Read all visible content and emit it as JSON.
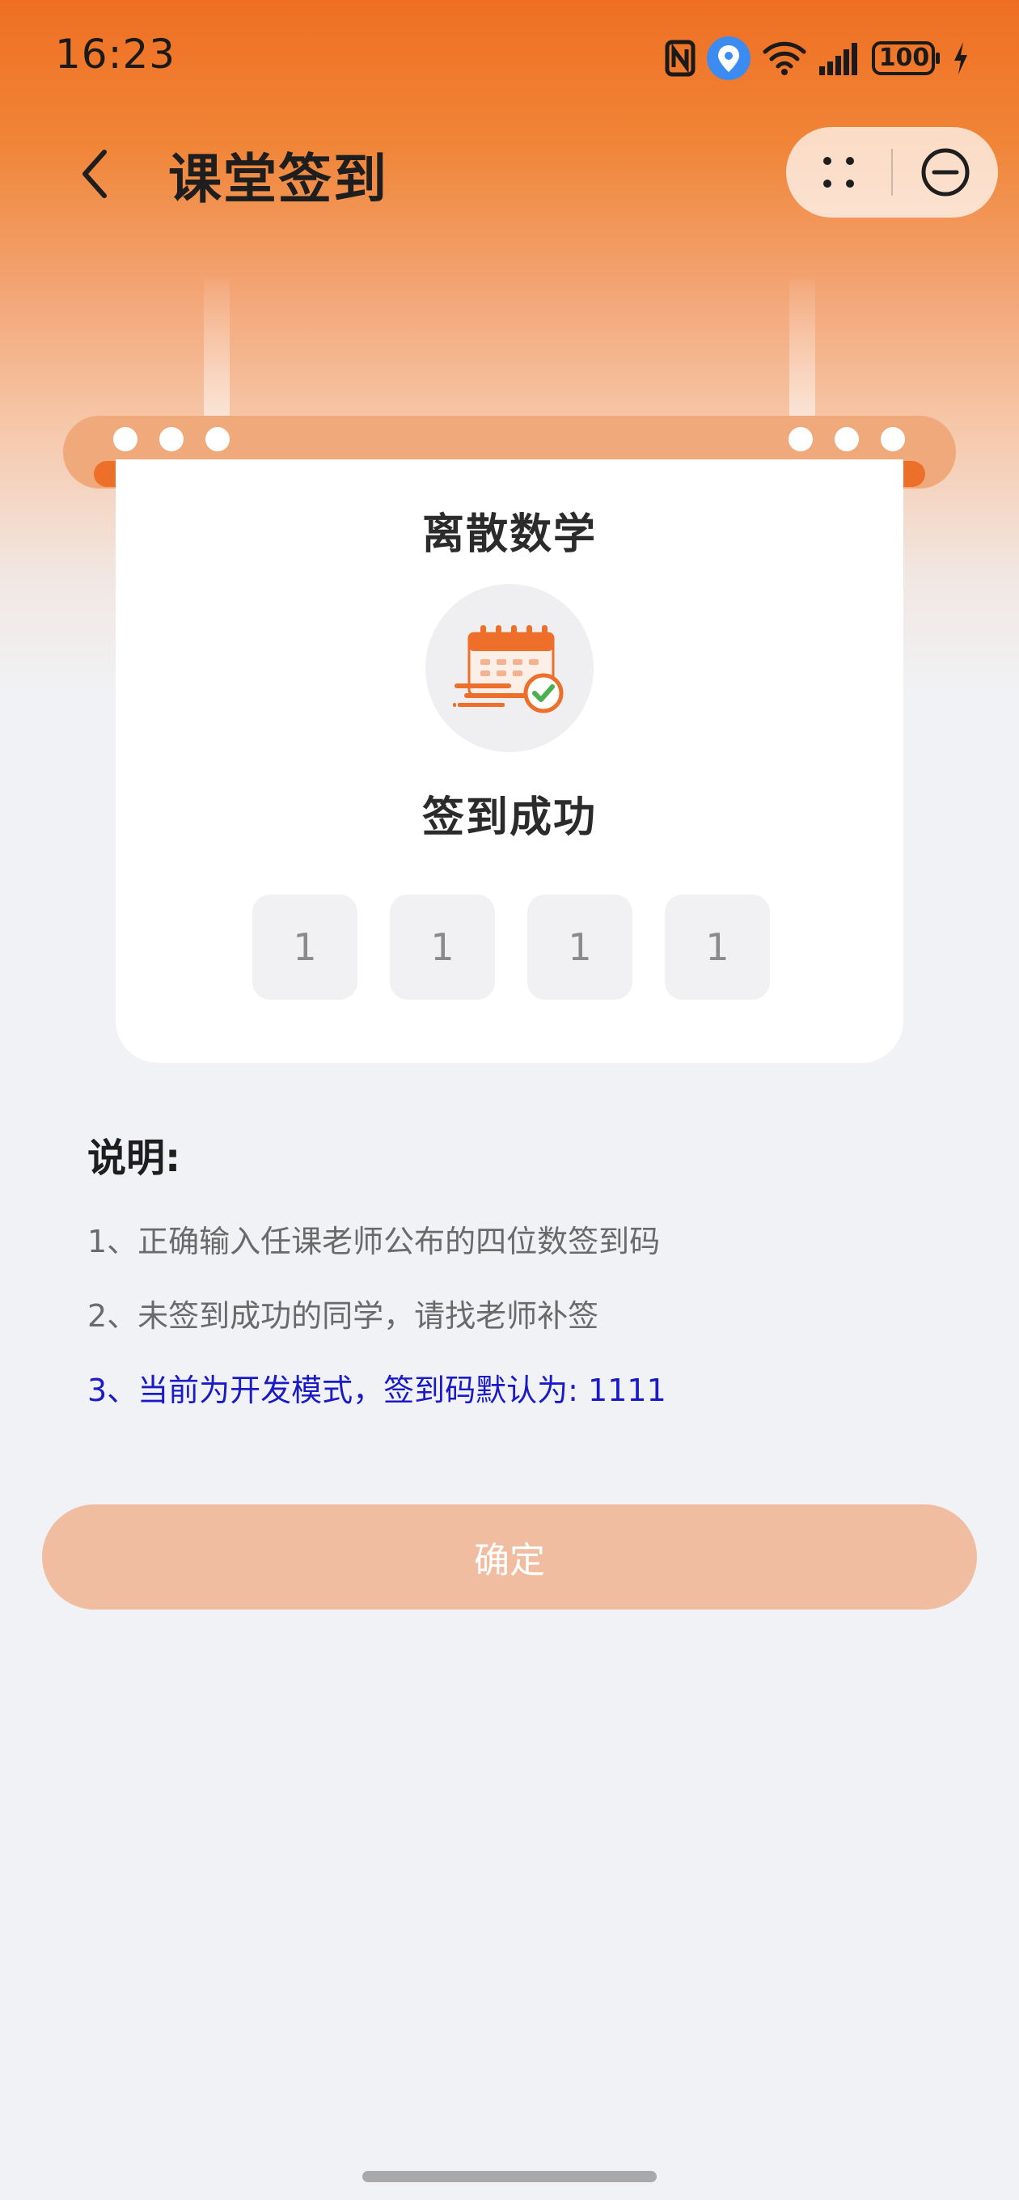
{
  "status_bar": {
    "time": "16:23",
    "battery": "100",
    "icons": [
      "nfc-icon",
      "location-icon",
      "wifi-icon",
      "signal-icon",
      "battery-icon",
      "charging-icon"
    ]
  },
  "header": {
    "title": "课堂签到",
    "back_icon": "chevron-left-icon",
    "capsule_icons": [
      "more-dots-icon",
      "minimize-circle-icon"
    ]
  },
  "card": {
    "course_name": "离散数学",
    "illustration_icon": "calendar-check-icon",
    "result_text": "签到成功",
    "code_digits": [
      "1",
      "1",
      "1",
      "1"
    ]
  },
  "instructions": {
    "title": "说明:",
    "items": [
      "1、正确输入任课老师公布的四位数签到码",
      "2、未签到成功的同学，请找老师补签",
      "3、当前为开发模式，签到码默认为: 1111"
    ]
  },
  "confirm_button": {
    "label": "确定"
  },
  "colors": {
    "accent": "#EF6F22",
    "button_disabled": "#F0BDA0",
    "highlight_text": "#1A1AC7"
  }
}
